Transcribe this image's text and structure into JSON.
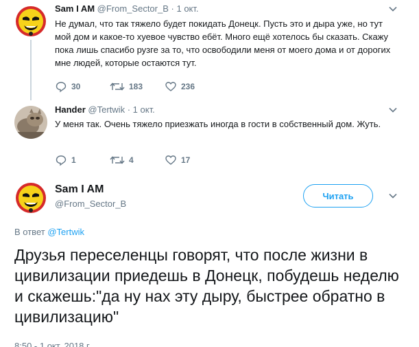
{
  "tweet1": {
    "name": "Sam I AM",
    "handle": "@From_Sector_B",
    "separator": "·",
    "time": "1 окт.",
    "text": "Не думал, что так тяжело будет покидать Донецк. Пусть это и дыра уже, но тут мой дом и какое-то хуевое чувство ебёт. Много ещё хотелось бы сказать. Скажу пока лишь спасибо рузге за то, что освободили меня от моего дома и от дорогих мне людей, которые остаются тут.",
    "replies": "30",
    "retweets": "183",
    "likes": "236"
  },
  "tweet2": {
    "name": "Hander",
    "handle": "@Tertwik",
    "separator": "·",
    "time": "1 окт.",
    "text": "У меня так. Очень тяжело приезжать иногда в гости в собственный дом. Жуть.",
    "replies": "1",
    "retweets": "4",
    "likes": "17"
  },
  "main": {
    "name": "Sam I AM",
    "handle": "@From_Sector_B",
    "follow_label": "Читать",
    "reply_prefix": "В ответ",
    "reply_mention": "@Tertwik",
    "text": "Друзья переселенцы говорят, что после жизни в цивилизации приедешь в Донецк, побудешь неделю и скажешь:\"да ну нах эту дыру, быстрее обратно в цивилизацию\"",
    "meta": "8:50 - 1 окт. 2018 г."
  },
  "colors": {
    "accent": "#1da1f2",
    "muted": "#657786",
    "text": "#14171a",
    "thread_line": "#ccd6dd"
  },
  "icons": {
    "reply": "reply-icon",
    "retweet": "retweet-icon",
    "like": "heart-icon",
    "menu": "chevron-down-icon"
  }
}
